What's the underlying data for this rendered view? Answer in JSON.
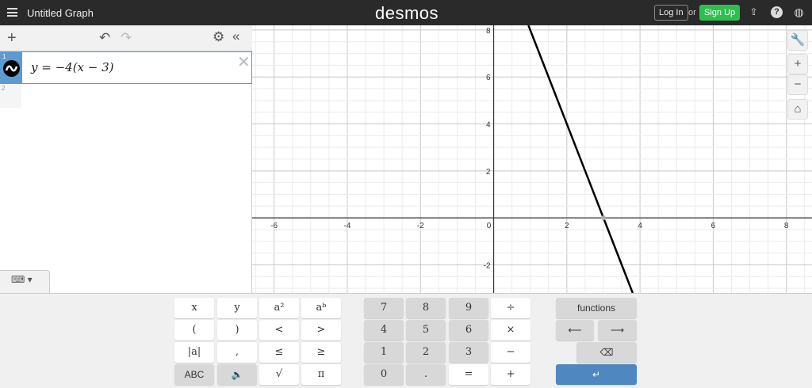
{
  "header": {
    "title": "Untitled Graph",
    "logo": "desmos",
    "login": "Log In",
    "or": "or",
    "signup": "Sign Up"
  },
  "sidebar": {
    "expressions": [
      {
        "index": "1",
        "latex": "y = −4(x − 3)"
      },
      {
        "index": "2",
        "latex": ""
      }
    ]
  },
  "graph": {
    "xmin": -6.6,
    "xmax": 8.7,
    "ymin": -3.2,
    "ymax": 8.2,
    "xticks": [
      -6,
      -4,
      -2,
      0,
      2,
      4,
      6,
      8
    ],
    "yticks": [
      -2,
      2,
      4,
      6,
      8
    ],
    "line": {
      "slope": -4,
      "root": 3,
      "color": "#000000"
    },
    "minor_step": 0.5
  },
  "keypad": {
    "left": [
      [
        "x",
        "y",
        "a²",
        "aᵇ"
      ],
      [
        "(",
        ")",
        "<",
        ">"
      ],
      [
        "|a|",
        ",",
        "≤",
        "≥"
      ],
      [
        "ABC",
        "🔈",
        "√",
        "π"
      ]
    ],
    "numbers": [
      [
        "7",
        "8",
        "9",
        "÷"
      ],
      [
        "4",
        "5",
        "6",
        "×"
      ],
      [
        "1",
        "2",
        "3",
        "−"
      ],
      [
        "0",
        ".",
        "=",
        "+"
      ]
    ],
    "functions": "functions",
    "left_arrow": "⟵",
    "right_arrow": "⟶",
    "backspace": "⌫",
    "enter": "↵"
  }
}
